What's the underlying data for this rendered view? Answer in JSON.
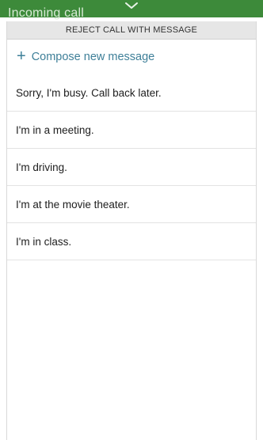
{
  "background": {
    "title": "Incoming call",
    "color": "#3d8a3a"
  },
  "panel": {
    "handle_icon": "chevron-down-icon",
    "header_title": "REJECT CALL WITH MESSAGE",
    "compose_icon": "plus-icon",
    "compose_label": "Compose new message",
    "accent_color": "#3e7f98",
    "messages": [
      "Sorry, I'm busy. Call back later.",
      "I'm in a meeting.",
      "I'm driving.",
      "I'm at the movie theater.",
      "I'm in class."
    ]
  }
}
